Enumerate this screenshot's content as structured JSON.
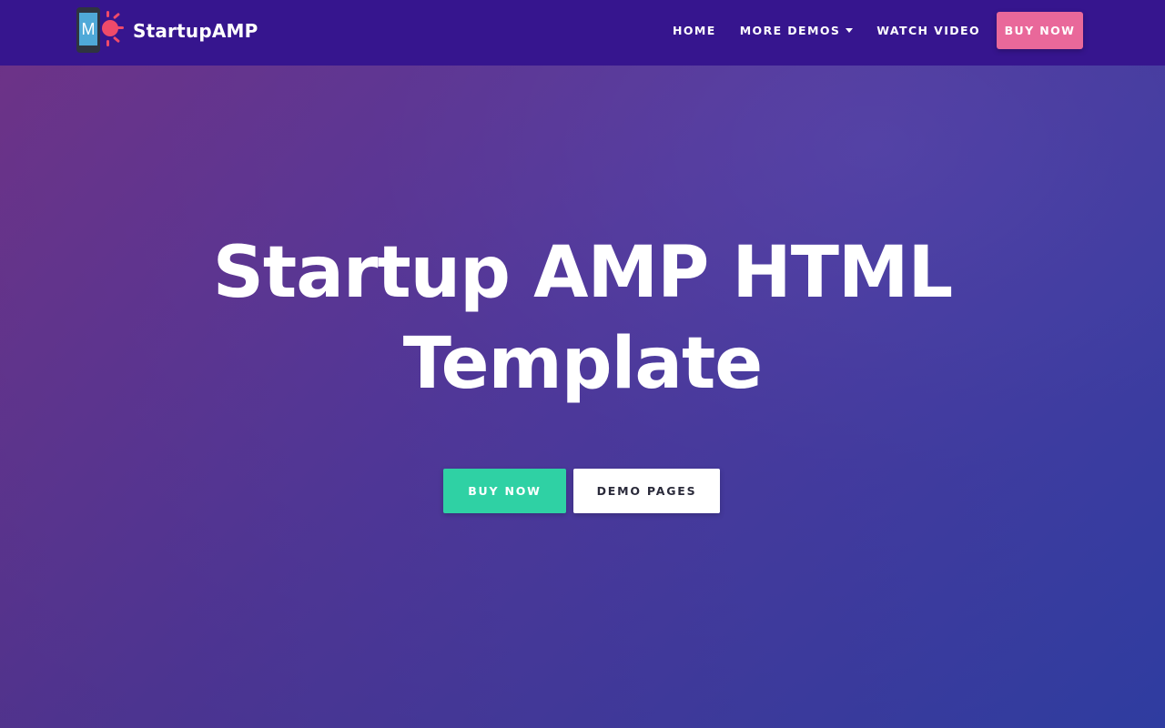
{
  "navbar": {
    "brand": {
      "name": "StartupAMP",
      "logo_letter": "M",
      "logo_icon": "phone-sun-logo-icon"
    },
    "links": [
      {
        "label": "HOME",
        "dropdown": false
      },
      {
        "label": "MORE DEMOS",
        "dropdown": true
      },
      {
        "label": "WATCH VIDEO",
        "dropdown": false
      }
    ],
    "buy_button": "BUY NOW"
  },
  "hero": {
    "title": "Startup AMP HTML Template",
    "primary_button": "BUY NOW",
    "secondary_button": "DEMO PAGES"
  },
  "colors": {
    "navbar_bg": "#36158e",
    "nav_buy_bg": "#e9689a",
    "primary_button_bg": "#2fd1a4",
    "secondary_button_bg": "#ffffff",
    "logo_phone_screen": "#4fa9d8",
    "logo_sun": "#ef4a6a"
  }
}
